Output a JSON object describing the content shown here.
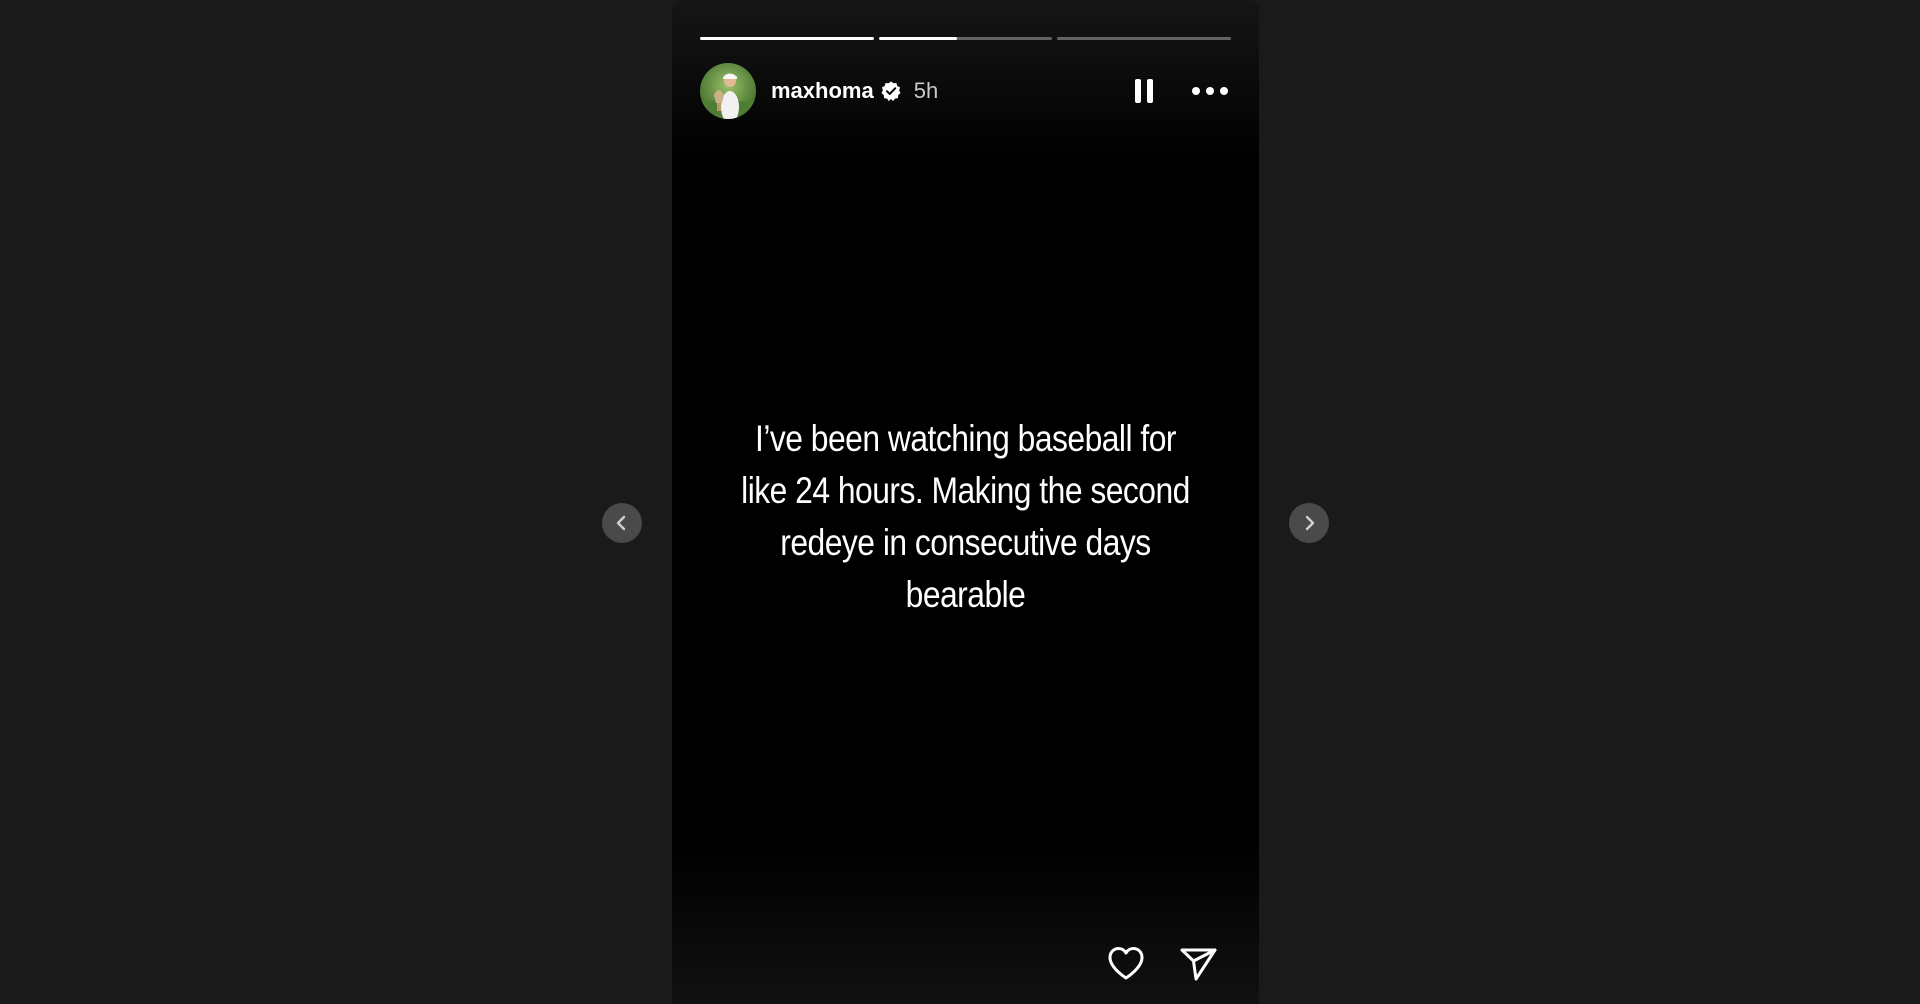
{
  "story": {
    "segments": [
      {
        "progress": 1.0
      },
      {
        "progress": 0.45
      },
      {
        "progress": 0.0
      }
    ],
    "author": {
      "username": "maxhoma",
      "verified": true,
      "avatar_icon": "profile-photo-golfer-with-trophy",
      "time_ago": "5h"
    },
    "controls": {
      "pause_icon": "pause-icon",
      "more_icon": "more-options-icon"
    },
    "text_lines": [
      "I’ve been watching baseball for",
      "like 24 hours. Making the second",
      "redeye in consecutive days",
      "bearable"
    ],
    "actions": {
      "like_icon": "heart-icon",
      "share_icon": "send-icon"
    }
  },
  "navigation": {
    "prev_icon": "chevron-left-icon",
    "next_icon": "chevron-right-icon"
  },
  "colors": {
    "page_background": "#1a1a1a",
    "story_background": "#000000",
    "text": "#ffffff",
    "timestamp": "#c9c9c9",
    "nav_button": "#4a4a4a"
  }
}
